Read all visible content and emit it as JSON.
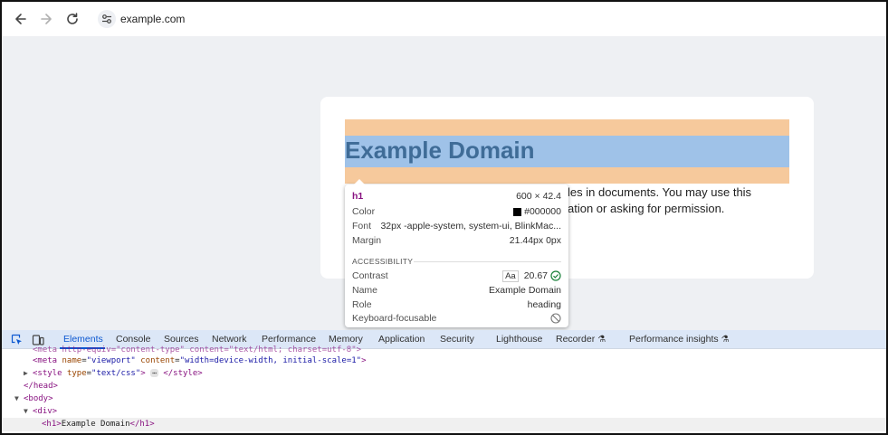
{
  "browser": {
    "url": "example.com"
  },
  "page": {
    "heading": "Example Domain",
    "paragraph_line1": "les in documents. You may use this",
    "paragraph_line2": "ation or asking for permission."
  },
  "tooltip": {
    "tag": "h1",
    "dimensions": "600 × 42.4",
    "color_label": "Color",
    "color_value": "#000000",
    "font_label": "Font",
    "font_value": "32px -apple-system, system-ui, BlinkMac...",
    "margin_label": "Margin",
    "margin_value": "21.44px 0px",
    "accessibility_title": "ACCESSIBILITY",
    "contrast_label": "Contrast",
    "contrast_aa": "Aa",
    "contrast_value": "20.67",
    "name_label": "Name",
    "name_value": "Example Domain",
    "role_label": "Role",
    "role_value": "heading",
    "keyboard_label": "Keyboard-focusable"
  },
  "devtools": {
    "tabs": [
      "Elements",
      "Console",
      "Sources",
      "Network",
      "Performance",
      "Memory",
      "Application",
      "Security",
      "Lighthouse",
      "Recorder",
      "Performance insights"
    ],
    "active_tab": "Elements",
    "code": {
      "line0": "<meta http-equiv=\"content-type\" content=\"text/html; charset=utf-8\">",
      "meta_tag_open": "<meta",
      "meta_attr1": "name",
      "meta_val1": "\"viewport\"",
      "meta_attr2": "content",
      "meta_val2": "\"width=device-width, initial-scale=1\"",
      "meta_close": ">",
      "style_open": "<style",
      "style_attr": "type",
      "style_val": "\"text/css\"",
      "style_gt": ">",
      "style_ellipsis": "⋯",
      "style_close": "</style>",
      "head_close": "</head>",
      "body_open": "<body>",
      "div_open": "<div>",
      "h1_open": "<h1>",
      "h1_text": "Example Domain",
      "h1_close": "</h1>"
    }
  },
  "colors": {
    "margin_highlight": "#f6c99c",
    "content_highlight": "#9fc2e8",
    "accent": "#0b57d0",
    "tag_color": "#881280",
    "success": "#188038"
  }
}
